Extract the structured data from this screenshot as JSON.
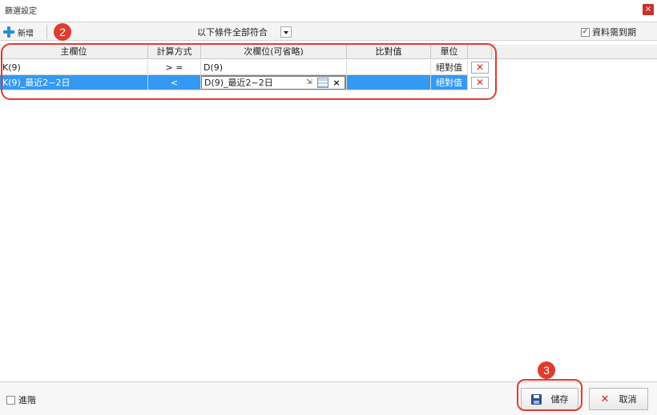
{
  "window": {
    "title": "篩選設定",
    "close": "×"
  },
  "toolbar": {
    "add_label": "新增",
    "condition_value": "以下條件全部符合",
    "expire_label": "資料需到期",
    "expire_checked": "✓"
  },
  "callouts": {
    "grid": "2",
    "save": "3"
  },
  "grid": {
    "headers": [
      "主欄位",
      "計算方式",
      "次欄位(可省略)",
      "比對值",
      "單位"
    ],
    "rows": [
      {
        "main": "K(9)",
        "op": "> =",
        "sub": "D(9)",
        "compare": "",
        "unit": "絕對值",
        "delete": "✕"
      },
      {
        "main": "K(9)_最近2~2日",
        "op": "<",
        "sub": "D(9)_最近2~2日",
        "compare": "",
        "unit": "絕對值",
        "delete": "✕"
      }
    ],
    "editor_clear": "×"
  },
  "footer": {
    "advanced_label": "進階",
    "save_label": "儲存",
    "cancel_label": "取消",
    "cancel_icon": "✕"
  },
  "colors": {
    "accent": "#3399f3",
    "callout": "#e03b2f",
    "delete": "#dd2222"
  }
}
